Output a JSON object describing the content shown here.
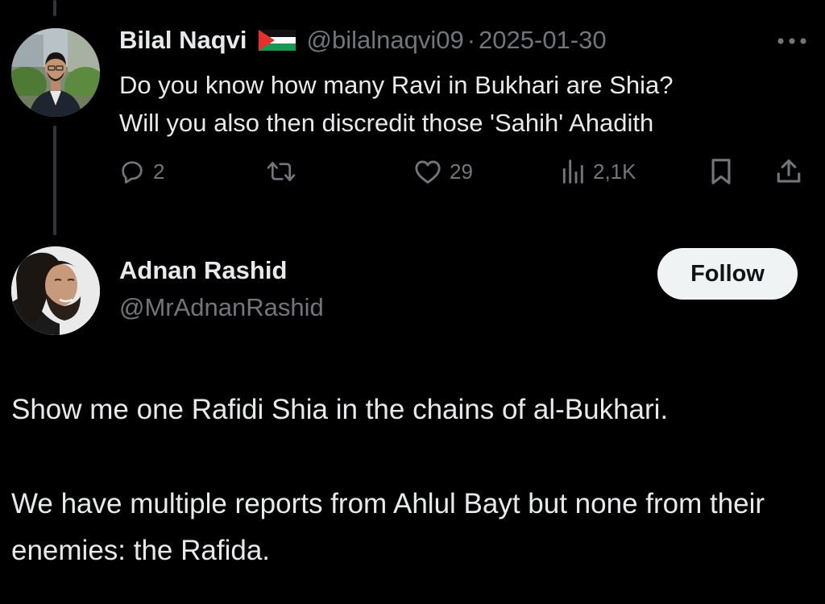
{
  "colors": {
    "background": "#000000",
    "primary_text": "#e7e9ea",
    "secondary_text": "#71767b",
    "follow_button_bg": "#eff3f4",
    "follow_button_text": "#0f1419"
  },
  "parent_tweet": {
    "author_name": "Bilal Naqvi",
    "author_flag": "palestine-flag-icon",
    "author_handle": "@bilalnaqvi09",
    "separator": "·",
    "date": "2025-01-30",
    "text": "Do you know how many Ravi in Bukhari are Shia?\nWill you also then discredit those 'Sahih' Ahadith",
    "replies": "2",
    "likes": "29",
    "views": "2,1K",
    "icons": {
      "reply": "reply-icon",
      "retweet": "retweet-icon",
      "like": "heart-icon",
      "views": "views-icon",
      "bookmark": "bookmark-icon",
      "share": "share-icon",
      "more": "more-icon"
    }
  },
  "main_tweet": {
    "author_name": "Adnan Rashid",
    "author_handle": "@MrAdnanRashid",
    "follow_label": "Follow",
    "paragraph_1": "Show me one Rafidi Shia in the chains of al-Bukhari.",
    "paragraph_2": "We have multiple reports from Ahlul Bayt but none from their enemies: the Rafida."
  }
}
